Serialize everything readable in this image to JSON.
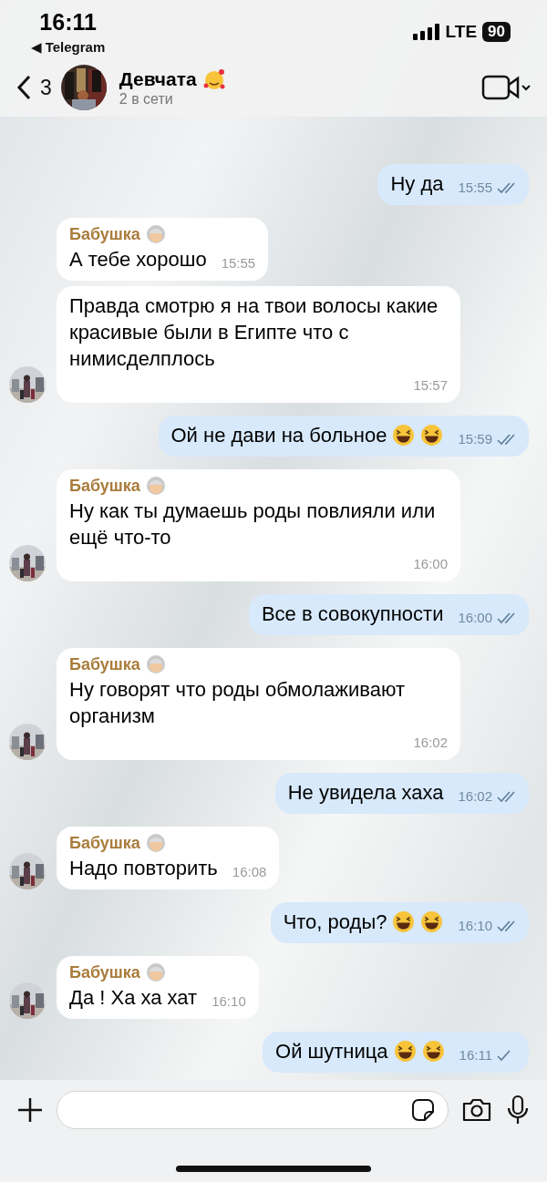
{
  "status_bar": {
    "time": "16:11",
    "back_app": "◀ Telegram",
    "network": "LTE",
    "battery": "90"
  },
  "header": {
    "back_count": "3",
    "title": "Девчата",
    "title_emoji": {
      "kind": "smiling-hearts"
    },
    "subtitle": "2 в сети"
  },
  "messages": [
    {
      "kind": "out",
      "text": "Ну да",
      "time": "15:55",
      "read": true
    },
    {
      "kind": "in",
      "sender": "Бабушка",
      "sender_emoji": {
        "kind": "old-woman"
      },
      "text": "А тебе хорошо",
      "time": "15:55",
      "avatar": false
    },
    {
      "kind": "in",
      "text": "Правда смотрю я на твои волосы какие красивые были  в Египте что с нимисделплось",
      "time": "15:57",
      "avatar": true
    },
    {
      "kind": "out",
      "text": "Ой не дави на больное",
      "emojis": [
        {
          "kind": "laughing"
        },
        {
          "kind": "laughing"
        }
      ],
      "time": "15:59",
      "read": true
    },
    {
      "kind": "in",
      "sender": "Бабушка",
      "sender_emoji": {
        "kind": "old-woman"
      },
      "text": "Ну как ты думаешь роды повлияли или ещё что-то",
      "time": "16:00",
      "avatar": true
    },
    {
      "kind": "out",
      "text": "Все в совокупности",
      "time": "16:00",
      "read": true
    },
    {
      "kind": "in",
      "sender": "Бабушка",
      "sender_emoji": {
        "kind": "old-woman"
      },
      "text": "Ну говорят что роды обмолаживают организм",
      "time": "16:02",
      "avatar": true
    },
    {
      "kind": "out",
      "text": "Не увидела хаха",
      "time": "16:02",
      "read": true
    },
    {
      "kind": "in",
      "sender": "Бабушка",
      "sender_emoji": {
        "kind": "old-woman"
      },
      "text": "Надо повторить",
      "time": "16:08",
      "avatar": true
    },
    {
      "kind": "out",
      "text": "Что, роды?",
      "emojis": [
        {
          "kind": "laughing"
        },
        {
          "kind": "laughing"
        }
      ],
      "time": "16:10",
      "read": true
    },
    {
      "kind": "in",
      "sender": "Бабушка",
      "sender_emoji": {
        "kind": "old-woman"
      },
      "text": "Да ! Ха ха хат",
      "time": "16:10",
      "avatar": true
    },
    {
      "kind": "out",
      "text": "Ой шутница",
      "emojis": [
        {
          "kind": "laughing"
        },
        {
          "kind": "laughing"
        }
      ],
      "time": "16:11",
      "read": false
    }
  ]
}
